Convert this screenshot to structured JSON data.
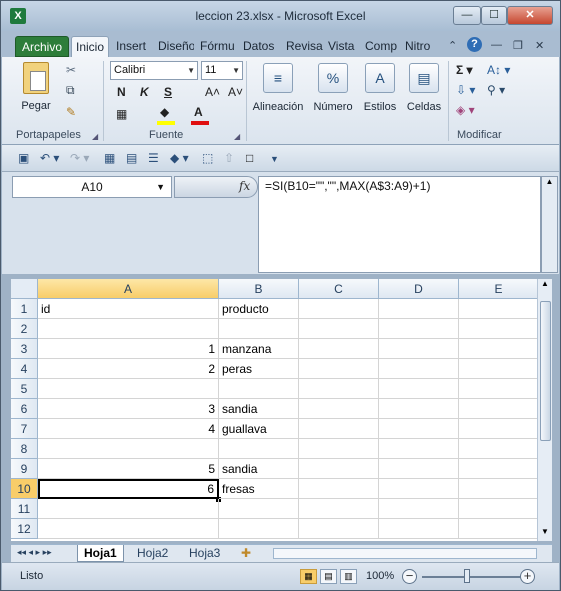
{
  "window": {
    "title": "leccion 23.xlsx  -  Microsoft Excel",
    "app_icon": "X",
    "minimize": "—",
    "maximize": "☐",
    "close": "✕"
  },
  "tabs": [
    "Archivo",
    "Inicio",
    "Insert",
    "Diseño",
    "Fórmu",
    "Datos",
    "Revisa",
    "Vista",
    "Comp",
    "Nitro"
  ],
  "ribbon": {
    "clipboard": {
      "label": "Portapapeles",
      "paste": "Pegar"
    },
    "font": {
      "label": "Fuente",
      "name": "Calibri",
      "size": "11",
      "bold": "N",
      "italic": "K",
      "underline": "S",
      "grow": "A˄",
      "shrink": "A˅"
    },
    "alignment": {
      "label": "Alineación"
    },
    "number": {
      "label": "Número"
    },
    "styles": {
      "label": "Estilos"
    },
    "cells": {
      "label": "Celdas"
    },
    "editing": {
      "label": "Modificar"
    }
  },
  "namebox": "A10",
  "formula": "=SI(B10=\"\",\"\",MAX(A$3:A9)+1)",
  "fx_label": "fx",
  "columns": [
    "A",
    "B",
    "C",
    "D",
    "E"
  ],
  "rows": [
    {
      "num": "1",
      "a": "id",
      "b": "producto"
    },
    {
      "num": "2",
      "a": "",
      "b": ""
    },
    {
      "num": "3",
      "a": "1",
      "b": "manzana"
    },
    {
      "num": "4",
      "a": "2",
      "b": "peras"
    },
    {
      "num": "5",
      "a": "",
      "b": ""
    },
    {
      "num": "6",
      "a": "3",
      "b": "sandia"
    },
    {
      "num": "7",
      "a": "4",
      "b": "guallava"
    },
    {
      "num": "8",
      "a": "",
      "b": ""
    },
    {
      "num": "9",
      "a": "5",
      "b": "sandia"
    },
    {
      "num": "10",
      "a": "6",
      "b": "fresas"
    },
    {
      "num": "11",
      "a": "",
      "b": ""
    },
    {
      "num": "12",
      "a": "",
      "b": ""
    }
  ],
  "sheets": [
    "Hoja1",
    "Hoja2",
    "Hoja3"
  ],
  "status": {
    "mode": "Listo",
    "zoom": "100%"
  }
}
